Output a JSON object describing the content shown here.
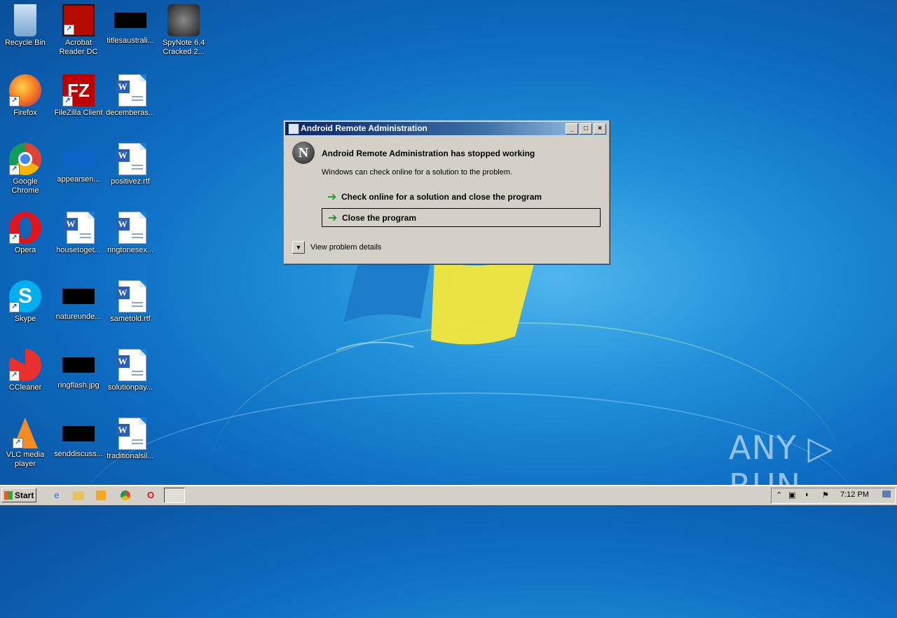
{
  "desktop": {
    "icons": [
      {
        "label": "Recycle Bin",
        "icon": "recycle-bin-icon"
      },
      {
        "label": "Acrobat Reader DC",
        "label2": "Reader DC",
        "label1": "Acrobat",
        "icon": "acrobat-icon"
      },
      {
        "label": "titlesaustrali...",
        "icon": "black-file-icon"
      },
      {
        "label1": "SpyNote 6.4",
        "label2": "Cracked 2...",
        "icon": "spynote-icon"
      },
      {
        "label": "Firefox",
        "icon": "firefox-icon"
      },
      {
        "label": "FileZilla Client",
        "icon": "filezilla-icon"
      },
      {
        "label": "decemberas...",
        "icon": "word-doc-icon"
      },
      {
        "label1": "Google",
        "label2": "Chrome",
        "icon": "chrome-icon"
      },
      {
        "label": "appearsen...",
        "icon": "blue-file-icon"
      },
      {
        "label": "positivez.rtf",
        "icon": "word-doc-icon"
      },
      {
        "label": "Opera",
        "icon": "opera-icon"
      },
      {
        "label": "housetoget...",
        "icon": "word-doc-icon"
      },
      {
        "label": "ringtonesex...",
        "icon": "word-doc-icon"
      },
      {
        "label": "Skype",
        "icon": "skype-icon"
      },
      {
        "label": "natureunde...",
        "icon": "black-file-icon"
      },
      {
        "label": "sametold.rtf",
        "icon": "word-doc-icon"
      },
      {
        "label": "CCleaner",
        "icon": "ccleaner-icon"
      },
      {
        "label": "ringflash.jpg",
        "icon": "black-file-icon"
      },
      {
        "label": "solutionpay...",
        "icon": "word-doc-icon"
      },
      {
        "label1": "VLC media",
        "label2": "player",
        "icon": "vlc-icon"
      },
      {
        "label": "senddiscuss...",
        "icon": "black-file-icon"
      },
      {
        "label": "traditionalsil...",
        "icon": "word-doc-icon"
      }
    ]
  },
  "dialog": {
    "title": "Android Remote Administration",
    "heading": "Android Remote Administration has stopped working",
    "subtext": "Windows can check online for a solution to the problem.",
    "option_check": "Check online for a solution and close the program",
    "option_close": "Close the program",
    "details": "View problem details",
    "app_icon_letter": "N"
  },
  "watermark": "ANY ▷ RUN",
  "taskbar": {
    "start": "Start",
    "clock": "7:12 PM"
  }
}
